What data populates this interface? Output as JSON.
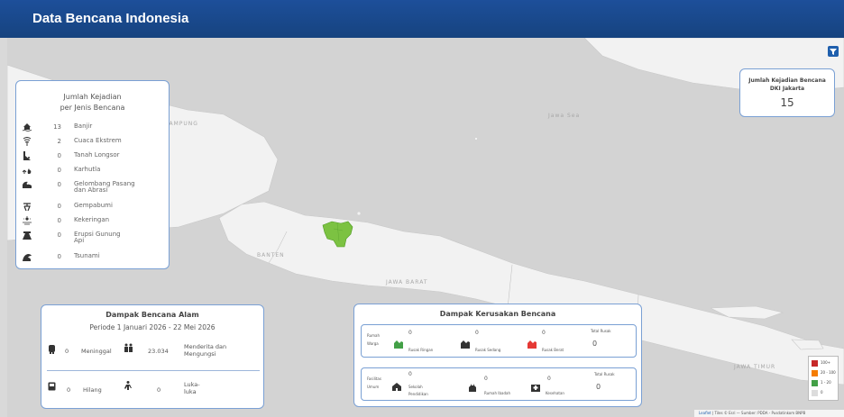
{
  "header": {
    "title": "Data Bencana Indonesia"
  },
  "map": {
    "labels": [
      {
        "text": "LAMPUNG"
      },
      {
        "text": "Jawa Sea"
      },
      {
        "text": "BANTEN"
      },
      {
        "text": "JAWA BARAT"
      },
      {
        "text": "JAWA TIMUR"
      }
    ]
  },
  "filter": {
    "icon": "filter-icon"
  },
  "jenis_kejadian": {
    "title_line1": "Jumlah Kejadian",
    "title_line2": "per Jenis Bencana",
    "items": [
      {
        "count": "13",
        "label": "Banjir",
        "icon": "flood-icon"
      },
      {
        "count": "2",
        "label": "Cuaca Ekstrem",
        "icon": "storm-icon"
      },
      {
        "count": "0",
        "label": "Tanah Longsor",
        "icon": "landslide-icon"
      },
      {
        "count": "0",
        "label": "Karhutla",
        "icon": "forest-fire-icon"
      },
      {
        "count": "0",
        "label": "Gelombang Pasang dan Abrasi",
        "icon": "wave-icon"
      },
      {
        "count": "0",
        "label": "Gempabumi",
        "icon": "earthquake-icon"
      },
      {
        "count": "0",
        "label": "Kekeringan",
        "icon": "drought-icon"
      },
      {
        "count": "0",
        "label": "Erupsi Gunung Api",
        "icon": "volcano-icon"
      },
      {
        "count": "0",
        "label": "Tsunami",
        "icon": "tsunami-icon"
      }
    ]
  },
  "dki": {
    "title_line1": "Jumlah Kejadian Bencana",
    "title_line2": "DKI Jakarta",
    "value": "15"
  },
  "dampak_alam": {
    "title": "Dampak Bencana Alam",
    "period": "Periode 1 Januari 2026 - 22 Mei 2026",
    "meninggal": {
      "value": "0",
      "label": "Meninggal"
    },
    "menderita": {
      "value": "23.034",
      "label_line1": "Menderita dan",
      "label_line2": "Mengungsi"
    },
    "hilang": {
      "value": "0",
      "label": "Hilang"
    },
    "luka": {
      "value": "0",
      "label_line1": "Luka-",
      "label_line2": "luka"
    }
  },
  "dampak_kerusakan": {
    "title": "Dampak Kerusakan Bencana",
    "rumah": {
      "label_line1": "Rumah",
      "label_line2": "Warga",
      "ringan": {
        "value": "0",
        "label": "Rusak Ringan"
      },
      "sedang": {
        "value": "0",
        "label": "Rusak Sedang"
      },
      "berat": {
        "value": "0",
        "label": "Rusak Berat"
      },
      "total": {
        "label": "Total Rusak",
        "value": "0"
      }
    },
    "fasilitas": {
      "label_line1": "Fasilitas",
      "label_line2": "Umum",
      "pendidikan": {
        "value": "0",
        "label_line1": "Sekolah",
        "label_line2": "Pendidikan"
      },
      "ibadah": {
        "value": "0",
        "label": "Rumah Ibadah"
      },
      "kesehatan": {
        "value": "0",
        "label": "Kesehatan"
      },
      "total": {
        "label": "Total Rusak",
        "value": "0"
      }
    }
  },
  "legend": {
    "items": [
      {
        "label": "100+",
        "color": "#c62828"
      },
      {
        "label": "20 - 100",
        "color": "#f57c00"
      },
      {
        "label": "1 - 20",
        "color": "#43a047"
      },
      {
        "label": "0",
        "color": "#dcdcdc"
      }
    ]
  },
  "attribution": {
    "link": "Leaflet",
    "text": " | Tiles © Esri — Sumber: PDDA - Pusdatinkom BNPB"
  }
}
